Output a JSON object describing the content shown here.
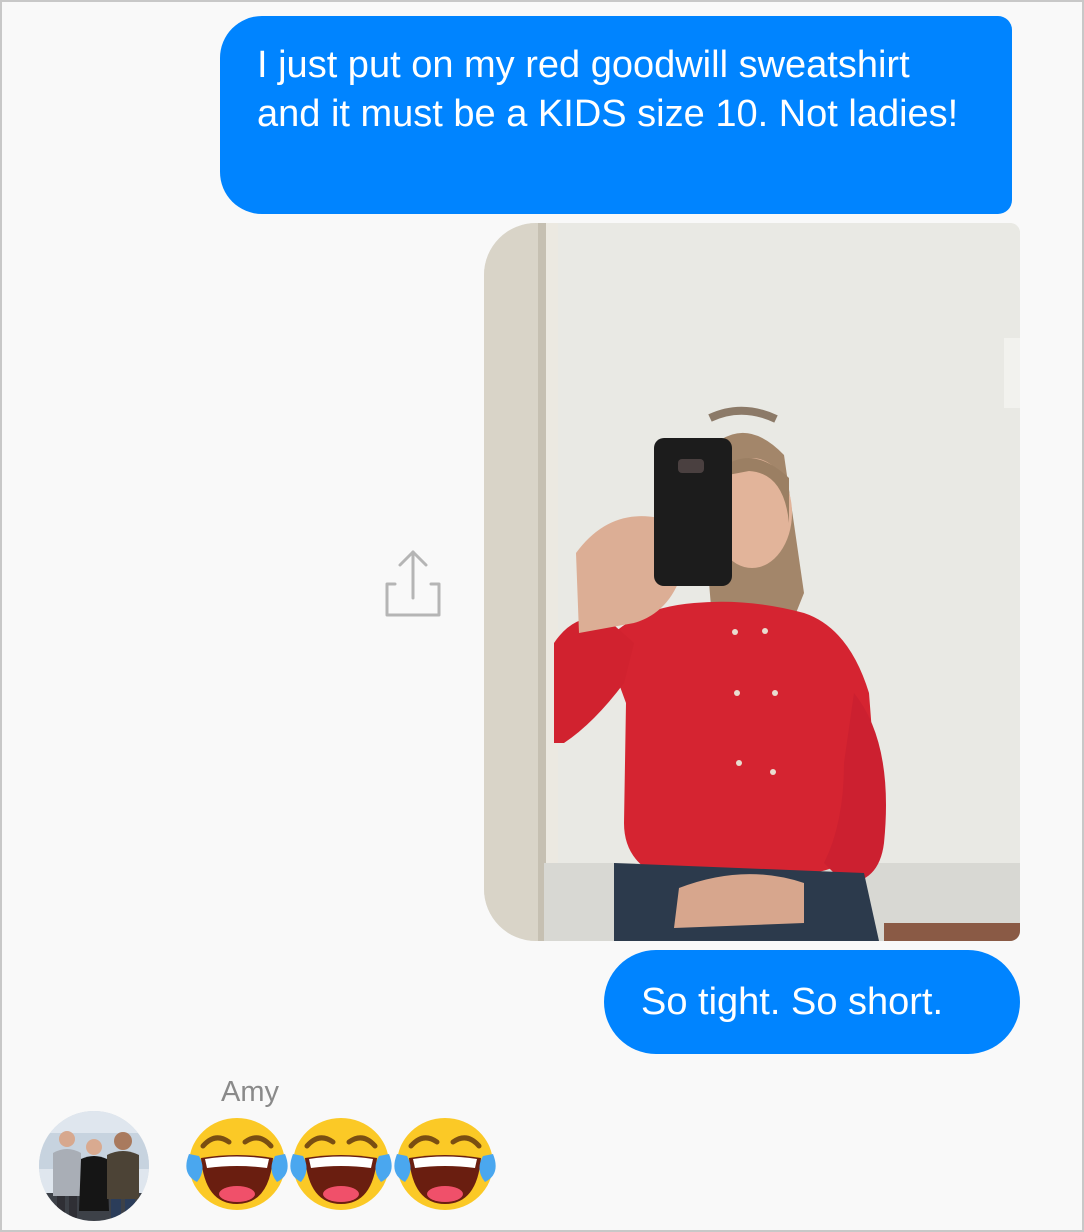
{
  "messages": {
    "outgoing_1": "I just put on my red goodwill sweatshirt and it must be a KIDS size 10. Not ladies!",
    "outgoing_2": "So tight. So short."
  },
  "reply": {
    "sender_name": "Amy",
    "emoji_names": [
      "face-with-tears-of-joy-icon",
      "face-with-tears-of-joy-icon",
      "face-with-tears-of-joy-icon"
    ]
  },
  "icons": {
    "share": "share-icon"
  },
  "colors": {
    "outgoing_bubble": "#0084ff",
    "outgoing_text": "#ffffff",
    "background": "#f9f9f9",
    "sender_name": "#8a8a8a"
  }
}
